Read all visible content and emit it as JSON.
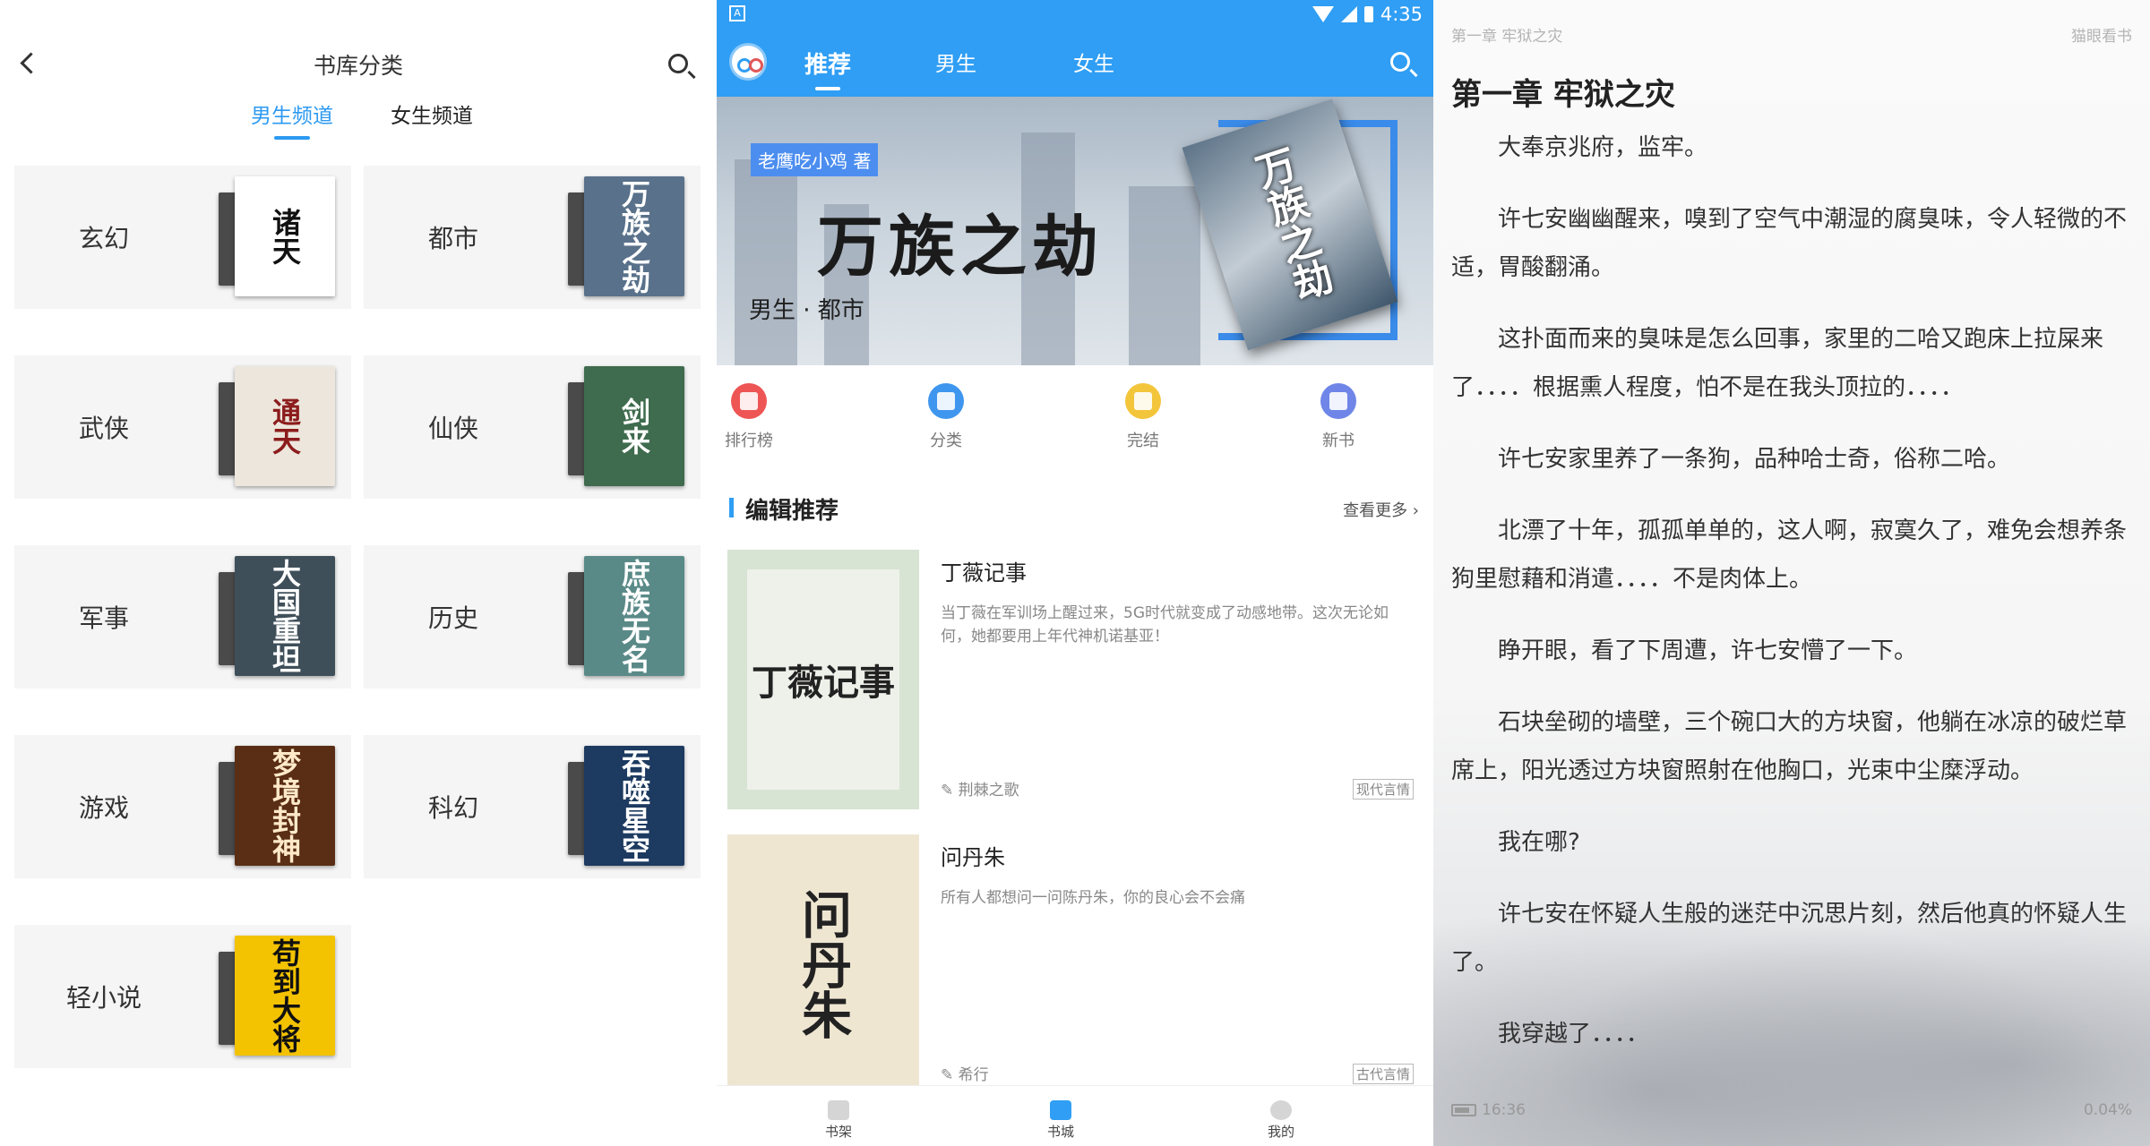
{
  "categories_screen": {
    "title": "书库分类",
    "tabs": [
      {
        "label": "男生频道",
        "active": true
      },
      {
        "label": "女生频道",
        "active": false
      }
    ],
    "categories": [
      {
        "label": "玄幻",
        "cover_text": "诸天",
        "cover_color": "#ffffff",
        "ink": "#111111"
      },
      {
        "label": "都市",
        "cover_text": "万族之劫",
        "cover_color": "#59718a",
        "ink": "#ffffff"
      },
      {
        "label": "武侠",
        "cover_text": "通天",
        "cover_color": "#ece6dc",
        "ink": "#8c1c1c"
      },
      {
        "label": "仙侠",
        "cover_text": "剑来",
        "cover_color": "#3f6b4e",
        "ink": "#ffffff"
      },
      {
        "label": "军事",
        "cover_text": "大国重坦",
        "cover_color": "#3f4f5a",
        "ink": "#ffffff"
      },
      {
        "label": "历史",
        "cover_text": "庶族无名",
        "cover_color": "#5a8a88",
        "ink": "#ffffff"
      },
      {
        "label": "游戏",
        "cover_text": "梦境封神",
        "cover_color": "#5a2e14",
        "ink": "#ffe9c8"
      },
      {
        "label": "科幻",
        "cover_text": "吞噬星空",
        "cover_color": "#1d3a60",
        "ink": "#ffffff"
      },
      {
        "label": "轻小说",
        "cover_text": "苟到大将",
        "cover_color": "#f3c200",
        "ink": "#111111"
      }
    ]
  },
  "city_screen": {
    "status_time": "4:35",
    "nav": [
      {
        "label": "推荐",
        "active": true
      },
      {
        "label": "男生",
        "active": false
      },
      {
        "label": "女生",
        "active": false
      }
    ],
    "banner": {
      "author_tag": "老鹰吃小鸡 著",
      "title": "万族之劫",
      "tags": "男生 · 都市"
    },
    "quick_nav": [
      {
        "label": "排行榜",
        "icon": "trophy-icon",
        "color": "#ee5555"
      },
      {
        "label": "分类",
        "icon": "grid-icon",
        "color": "#3f96ee"
      },
      {
        "label": "完结",
        "icon": "tag-icon",
        "color": "#f3c53b"
      },
      {
        "label": "新书",
        "icon": "book-icon",
        "color": "#6f86e8"
      }
    ],
    "section": {
      "title": "编辑推荐",
      "more": "查看更多 ›"
    },
    "books": [
      {
        "title": "丁薇记事",
        "desc": "当丁薇在军训场上醒过来，5G时代就变成了动感地带。这次无论如何，她都要用上年代神机诺基亚！",
        "author": "✎ 荆棘之歌",
        "genre": "现代言情",
        "cover_text": "丁薇记事",
        "cover_color": "#eef1ea",
        "ink": "#222222"
      },
      {
        "title": "问丹朱",
        "desc": "所有人都想问一问陈丹朱，你的良心会不会痛",
        "author": "✎ 希行",
        "genre": "古代言情",
        "cover_text": "问丹朱",
        "cover_color": "#efe6d2",
        "ink": "#222222"
      }
    ],
    "tabbar": [
      {
        "label": "书架",
        "active": false
      },
      {
        "label": "书城",
        "active": true
      },
      {
        "label": "我的",
        "active": false
      }
    ]
  },
  "reader_screen": {
    "header_chapter": "第一章 牢狱之灾",
    "app_name": "猫眼看书",
    "chapter_title": "第一章 牢狱之灾",
    "paragraphs": [
      "大奉京兆府，监牢。",
      "许七安幽幽醒来，嗅到了空气中潮湿的腐臭味，令人轻微的不适，胃酸翻涌。",
      "这扑面而来的臭味是怎么回事，家里的二哈又跑床上拉屎来了．．．．根据熏人程度，怕不是在我头顶拉的．．．．",
      "许七安家里养了一条狗，品种哈士奇，俗称二哈。",
      "北漂了十年，孤孤单单的，这人啊，寂寞久了，难免会想养条狗里慰藉和消遣．．．．不是肉体上。",
      "睁开眼，看了下周遭，许七安懵了一下。",
      "石块垒砌的墙壁，三个碗口大的方块窗，他躺在冰凉的破烂草席上，阳光透过方块窗照射在他胸口，光束中尘糜浮动。",
      "我在哪?",
      "许七安在怀疑人生般的迷茫中沉思片刻，然后他真的怀疑人生了。",
      "我穿越了．．．．"
    ],
    "battery_time": "16:36",
    "progress": "0.04%"
  }
}
